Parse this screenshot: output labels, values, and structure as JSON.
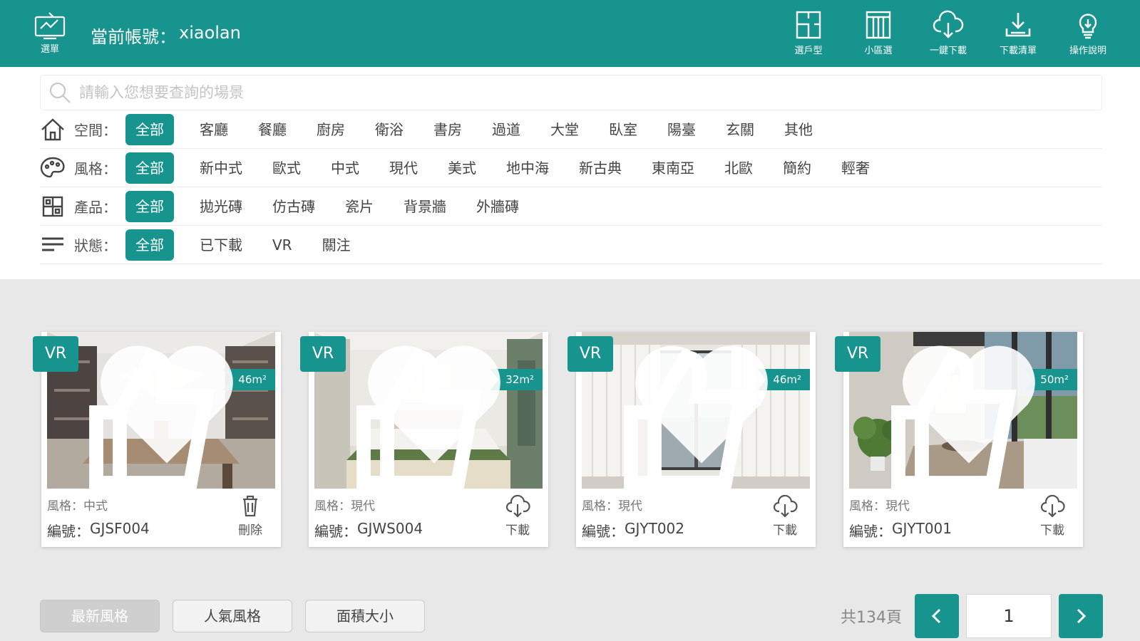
{
  "header": {
    "menu_label": "選單",
    "account_label": "當前帳號：",
    "account_value": "xiaolan",
    "tools": [
      {
        "icon": "floorplan-icon",
        "label": "選戶型"
      },
      {
        "icon": "building-icon",
        "label": "小區選"
      },
      {
        "icon": "cloud-download-icon",
        "label": "一鍵下載"
      },
      {
        "icon": "download-list-icon",
        "label": "下載清單"
      },
      {
        "icon": "lightbulb-icon",
        "label": "操作說明"
      }
    ]
  },
  "search": {
    "placeholder": "請輸入您想要查詢的場景"
  },
  "filters": {
    "space": {
      "label": "空間：",
      "options": [
        "全部",
        "客廳",
        "餐廳",
        "廚房",
        "衛浴",
        "書房",
        "過道",
        "大堂",
        "臥室",
        "陽臺",
        "玄關",
        "其他"
      ]
    },
    "style": {
      "label": "風格：",
      "options": [
        "全部",
        "新中式",
        "歐式",
        "中式",
        "現代",
        "美式",
        "地中海",
        "新古典",
        "東南亞",
        "北歐",
        "簡約",
        "輕奢"
      ]
    },
    "product": {
      "label": "產品：",
      "options": [
        "全部",
        "拋光磚",
        "仿古磚",
        "瓷片",
        "背景牆",
        "外牆磚"
      ]
    },
    "status": {
      "label": "狀態：",
      "options": [
        "全部",
        "已下載",
        "VR",
        "關注"
      ]
    }
  },
  "cards": [
    {
      "vr": "VR",
      "likes": "129",
      "area": "46m²",
      "style_label": "風格：",
      "style": "中式",
      "code_label": "編號：",
      "code": "GJSF004",
      "action": "刪除",
      "action_icon": "trash-icon"
    },
    {
      "vr": "VR",
      "likes": "15",
      "area": "32m²",
      "style_label": "風格：",
      "style": "現代",
      "code_label": "編號：",
      "code": "GJWS004",
      "action": "下載",
      "action_icon": "cloud-download-icon"
    },
    {
      "vr": "VR",
      "likes": "7",
      "area": "46m²",
      "style_label": "風格：",
      "style": "現代",
      "code_label": "編號：",
      "code": "GJYT002",
      "action": "下載",
      "action_icon": "cloud-download-icon"
    },
    {
      "vr": "VR",
      "likes": "15",
      "area": "50m²",
      "style_label": "風格：",
      "style": "現代",
      "code_label": "編號：",
      "code": "GJYT001",
      "action": "下載",
      "action_icon": "cloud-download-icon"
    }
  ],
  "sort": [
    "最新風格",
    "人氣風格",
    "面積大小"
  ],
  "pager": {
    "total": "共134頁",
    "current": "1"
  },
  "colors": {
    "brand": "#17948e",
    "background": "#e8e8e8"
  }
}
